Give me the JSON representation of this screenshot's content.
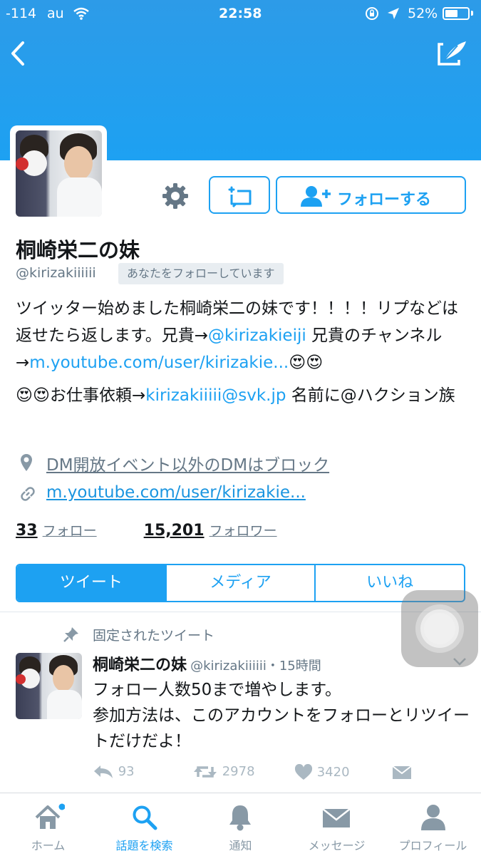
{
  "status_bar": {
    "signal": "-114",
    "carrier": "au",
    "time": "22:58",
    "battery": "52%"
  },
  "colors": {
    "accent": "#1da1f2",
    "text": "#14171a",
    "muted": "#657786"
  },
  "header": {
    "back_icon": "chevron-left-icon",
    "compose_icon": "quill-compose-icon"
  },
  "profile": {
    "name": "桐崎栄二の妹",
    "handle": "@kirizakiiiiii",
    "follows_you": "あなたをフォローしています",
    "bio_1": "ツイッター始めました桐崎栄二の妹です！！！！リプなどは返せたら返します。兄貴→",
    "bio_link_1": "@kirizakieiji",
    "bio_2": " 兄貴のチャンネル→",
    "bio_link_2": "m.youtube.com/user/kirizakie...",
    "bio_3": "お仕事依頼→",
    "bio_link_3": "kirizakiiiii@svk.jp",
    "bio_4": " 名前に@ハクション族",
    "location": "DM開放イベント以外のDMはブロック",
    "website": "m.youtube.com/user/kirizakie...",
    "following_count": "33",
    "following_label": "フォロー",
    "followers_count": "15,201",
    "followers_label": "フォロワー"
  },
  "buttons": {
    "follow": "フォローする"
  },
  "tabs": [
    "ツイート",
    "メディア",
    "いいね"
  ],
  "tweet": {
    "pinned_label": "固定されたツイート",
    "author": "桐崎栄二の妹",
    "handle_time": "@kirizakiiiiii・15時間",
    "text_1": "フォロー人数50まで増やします。",
    "text_2": "参加方法は、このアカウントをフォローとリツイートだけだよ！",
    "replies": "93",
    "retweets": "2978",
    "likes": "3420"
  },
  "tabbar": [
    "ホーム",
    "話題を検索",
    "通知",
    "メッセージ",
    "プロフィール"
  ]
}
